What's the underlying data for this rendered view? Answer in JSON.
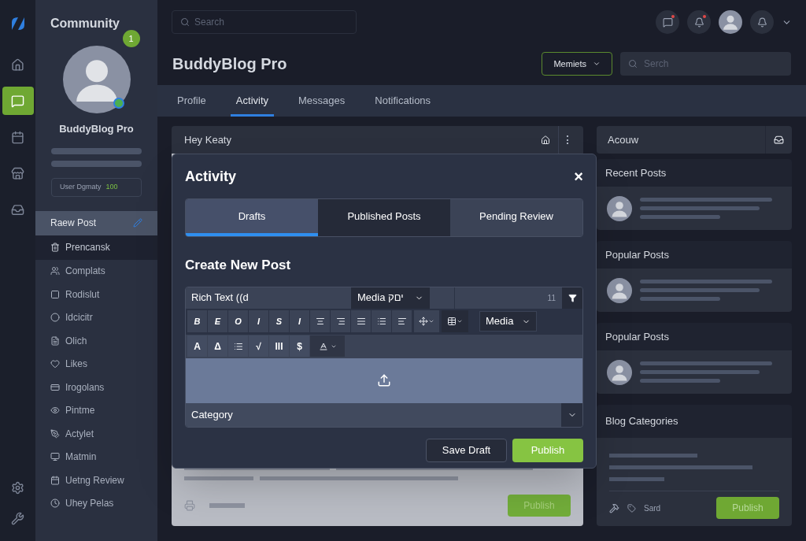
{
  "rail": {
    "items": [
      {
        "selected": false
      },
      {
        "selected": true
      },
      {
        "selected": false
      },
      {
        "selected": false
      },
      {
        "selected": false
      }
    ]
  },
  "sidebar": {
    "title": "Community",
    "badge": "1",
    "profile_name": "BuddyBlog Pro",
    "stat_label": "User Dgmaty",
    "stat_value": "100",
    "items": [
      {
        "label": "Raew Post",
        "selected": true,
        "hovered": false
      },
      {
        "label": "Prencansk",
        "selected": false,
        "hovered": true
      },
      {
        "label": "Complats",
        "selected": false,
        "hovered": false
      },
      {
        "label": "Rodislut",
        "selected": false,
        "hovered": false
      },
      {
        "label": "Idcicitr",
        "selected": false,
        "hovered": false
      },
      {
        "label": "Olich",
        "selected": false,
        "hovered": false
      },
      {
        "label": "Likes",
        "selected": false,
        "hovered": false
      },
      {
        "label": "Irogolans",
        "selected": false,
        "hovered": false
      },
      {
        "label": "Pintme",
        "selected": false,
        "hovered": false
      },
      {
        "label": "Actylet",
        "selected": false,
        "hovered": false
      },
      {
        "label": "Matmin",
        "selected": false,
        "hovered": false
      },
      {
        "label": "Uetng Review",
        "selected": false,
        "hovered": false
      },
      {
        "label": "Uhey Pelas",
        "selected": false,
        "hovered": false
      }
    ]
  },
  "topbar": {
    "search_placeholder": "Search"
  },
  "header": {
    "title": "BuddyBlog Pro",
    "dropdown": "Memiets",
    "search_placeholder": "Serch"
  },
  "tabs": [
    {
      "label": "Profile",
      "selected": false
    },
    {
      "label": "Activity",
      "selected": true
    },
    {
      "label": "Messages",
      "selected": false
    },
    {
      "label": "Notifications",
      "selected": false
    }
  ],
  "main_card": {
    "title": "Hey Keaty",
    "button": "Publish"
  },
  "right": {
    "header": "Acouw",
    "cards": [
      {
        "title": "Recent Posts"
      },
      {
        "title": "Popular Posts"
      },
      {
        "title": "Popular Posts"
      }
    ],
    "categories": {
      "title": "Blog Categories",
      "footer_label": "Sard",
      "button": "Publish"
    }
  },
  "modal": {
    "title": "Activity",
    "close": "×",
    "tabs": [
      {
        "label": "Drafts",
        "selected": true
      },
      {
        "label": "Published Posts",
        "selected": false
      },
      {
        "label": "Pending Review",
        "selected": false
      }
    ],
    "heading": "Create New Post",
    "editor": {
      "format_value": "Rich Text ((d",
      "media_select": "Media יםק",
      "size_value": "11",
      "media_dropdown": "Media",
      "toolbar_1": [
        {
          "kind": "text",
          "label": "B"
        },
        {
          "kind": "text",
          "label": "E"
        },
        {
          "kind": "text",
          "label": "O"
        },
        {
          "kind": "text",
          "label": "I"
        },
        {
          "kind": "text",
          "label": "S"
        },
        {
          "kind": "text",
          "label": "I"
        },
        {
          "kind": "icon"
        },
        {
          "kind": "icon"
        },
        {
          "kind": "icon"
        },
        {
          "kind": "icon"
        },
        {
          "kind": "icon"
        }
      ],
      "toolbar_2": [
        {
          "kind": "text",
          "label": "A"
        },
        {
          "kind": "text",
          "label": "Δ"
        },
        {
          "kind": "icon"
        },
        {
          "kind": "text",
          "label": "√"
        },
        {
          "kind": "text",
          "label": "III"
        },
        {
          "kind": "text",
          "label": "$"
        }
      ],
      "category_placeholder": "Category"
    },
    "buttons": {
      "secondary": "Save Draft",
      "primary": "Publish"
    }
  }
}
